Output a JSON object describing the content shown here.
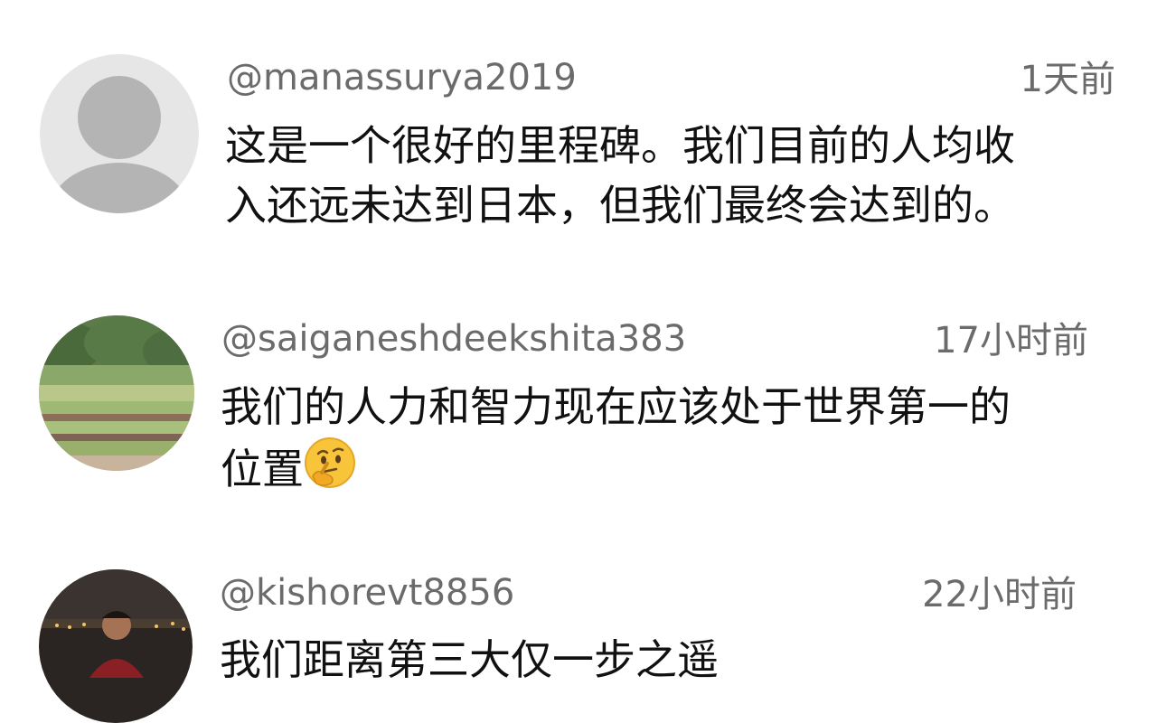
{
  "comments": [
    {
      "handle": "@manassurya2019",
      "time": "1天前",
      "lines": [
        "这是一个很好的里程碑。我们目前的人均收",
        "入还远未达到日本，但我们最终会达到的。"
      ],
      "avatar": "default-avatar-icon"
    },
    {
      "handle": "@saiganeshdeekshita383",
      "time": "17小时前",
      "lines": [
        "我们的人力和智力现在应该处于世界第一的",
        "位置"
      ],
      "emoji": "thinking-face-icon",
      "avatar": "landscape-photo"
    },
    {
      "handle": "@kishorevt8856",
      "time": "22小时前",
      "lines": [
        "我们距离第三大仅一步之遥"
      ],
      "avatar": "person-photo"
    }
  ],
  "colors": {
    "handle": "#6b6b6b",
    "text": "#111111",
    "avatar_default_bg": "#e6e6e6",
    "avatar_default_fg": "#b4b4b4"
  }
}
